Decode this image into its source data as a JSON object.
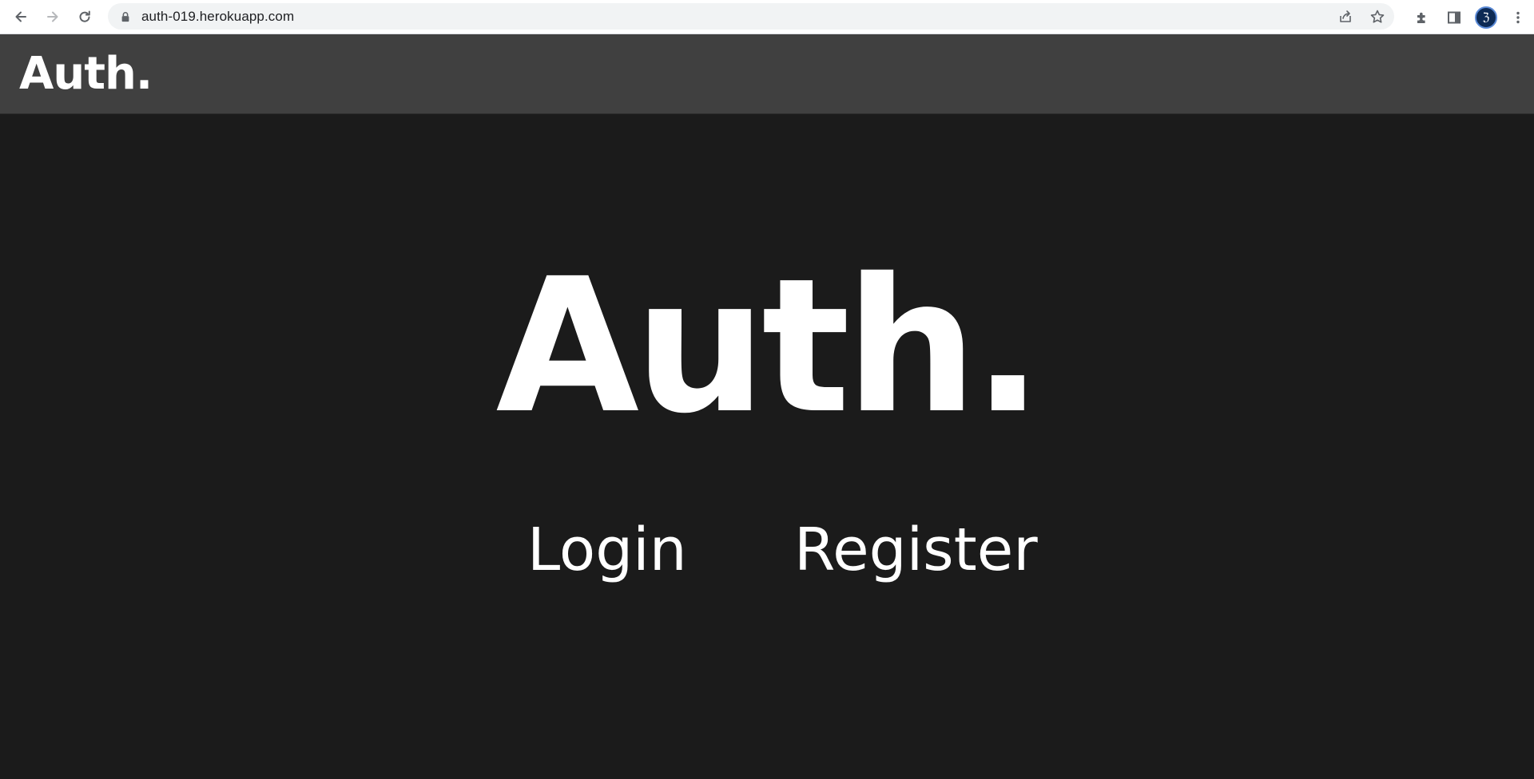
{
  "browser": {
    "url": "auth-019.herokuapp.com",
    "avatar_glyph": "ℨ"
  },
  "header": {
    "logo": "Auth."
  },
  "main": {
    "title": "Auth.",
    "links": {
      "login": "Login",
      "register": "Register"
    }
  },
  "colors": {
    "page_background": "#1b1b1b",
    "header_background": "#404040",
    "text": "#ffffff"
  },
  "icons": {
    "back": "arrow-left-icon",
    "forward": "arrow-right-icon",
    "reload": "reload-icon",
    "lock": "lock-icon",
    "share": "share-icon",
    "bookmark": "star-icon",
    "extensions": "puzzle-icon",
    "side_panel": "side-panel-icon",
    "menu": "kebab-menu-icon"
  }
}
